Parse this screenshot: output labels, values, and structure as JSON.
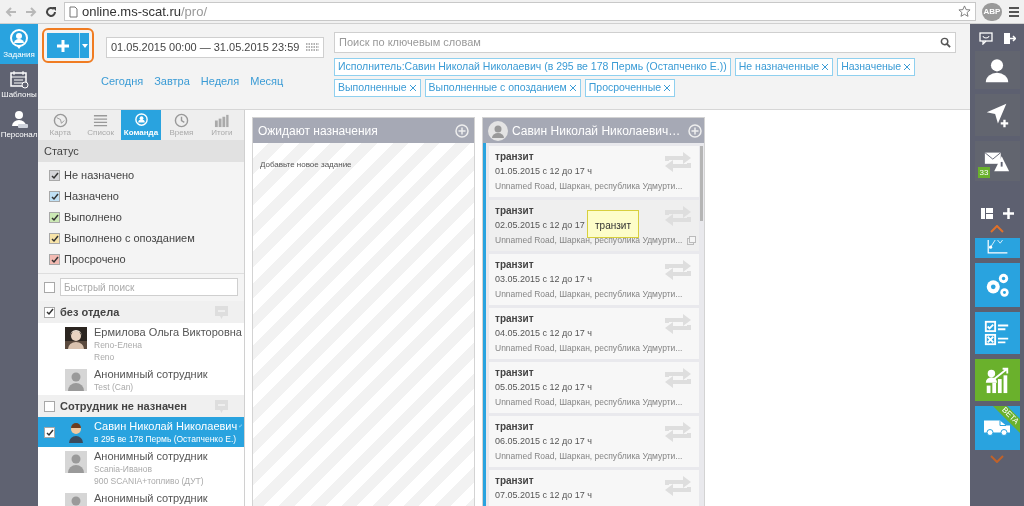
{
  "browser": {
    "url_host": "online.ms-scat.ru",
    "url_path": "/pro/",
    "extension": "ABP"
  },
  "left_nav": [
    {
      "kind": "tasks",
      "label": "Задания",
      "selected": true
    },
    {
      "kind": "templates",
      "label": "Шаблоны",
      "selected": false
    },
    {
      "kind": "staff",
      "label": "Персонал",
      "selected": false
    }
  ],
  "toolbar": {
    "date_range": "01.05.2015 00:00 — 31.05.2015 23:59",
    "quick_ranges": [
      "Сегодня",
      "Завтра",
      "Неделя",
      "Месяц"
    ],
    "search": {
      "placeholder": "Поиск по ключевым словам"
    },
    "filters": [
      "Исполнитель:Савин Николай Николаевич (в 295 ве 178 Пермь (Остапченко Е.))",
      "Не назначенные",
      "Назначеные",
      "Выполненные",
      "Выполненные с опозданием",
      "Просроченные"
    ]
  },
  "view_tabs": [
    {
      "kind": "map",
      "label": "Карта",
      "selected": false
    },
    {
      "kind": "list",
      "label": "Список",
      "selected": false
    },
    {
      "kind": "team",
      "label": "Команда",
      "selected": true
    },
    {
      "kind": "time",
      "label": "Время",
      "selected": false
    },
    {
      "kind": "totals",
      "label": "Итоги",
      "selected": false
    }
  ],
  "status": {
    "title": "Статус",
    "items": [
      {
        "label": "Не назначено",
        "checked": true,
        "color": "#d4d4d8"
      },
      {
        "label": "Назначено",
        "checked": true,
        "color": "#bfe0f5"
      },
      {
        "label": "Выполнено",
        "checked": true,
        "color": "#cbe8b4"
      },
      {
        "label": "Выполнено с опозданием",
        "checked": true,
        "color": "#f7e3a8"
      },
      {
        "label": "Просрочено",
        "checked": true,
        "color": "#f2bab2"
      }
    ]
  },
  "quick_search": {
    "placeholder": "Быстрый поиск",
    "checked": false
  },
  "groups": [
    {
      "name": "без отдела",
      "checked": true,
      "members": [
        {
          "name": "Ермилова Ольга Викторовна",
          "lines": [
            "Reno-Елена",
            "Reno"
          ],
          "selected": false
        },
        {
          "name": "Анонимный сотрудник",
          "lines": [
            "Test (Can)"
          ],
          "kind": "anonymous",
          "selected": false
        }
      ]
    },
    {
      "name": "Сотрудник не назначен",
      "checked": false,
      "members": [
        {
          "name": "Савин Николай Николаевич",
          "lines": [
            "в 295 ве 178 Пермь (Остапченко Е.)"
          ],
          "kind": "figure",
          "selected": true
        },
        {
          "name": "Анонимный сотрудник",
          "lines": [
            "Scania-Иванов",
            "900 SCANIA+топливо (ДУТ)"
          ],
          "kind": "anonymous",
          "selected": false
        },
        {
          "name": "Анонимный сотрудник",
          "kind": "anonymous",
          "selected": false
        }
      ]
    }
  ],
  "board": {
    "columns": [
      {
        "kind": "unassigned",
        "title": "Ожидают назначения",
        "empty_text": "Добавьте новое задание"
      },
      {
        "kind": "person",
        "title": "Савин Николай Николаевич…",
        "cards": [
          {
            "title": "транзит",
            "date": "01.05.2015 с 12 до 17 ч",
            "address": "Unnamed Road, Шаркан, республика Удмурти...",
            "hovered": false
          },
          {
            "title": "транзит",
            "date": "02.05.2015 с 12 до 17",
            "address": "Unnamed Road, Шаркан, республика Удмурти...",
            "hovered": true,
            "tooltip": "транзит"
          },
          {
            "title": "транзит",
            "date": "03.05.2015 с 12 до 17 ч",
            "address": "Unnamed Road, Шаркан, республика Удмурти...",
            "hovered": false
          },
          {
            "title": "транзит",
            "date": "04.05.2015 с 12 до 17 ч",
            "address": "Unnamed Road, Шаркан, республика Удмурти...",
            "hovered": false
          },
          {
            "title": "транзит",
            "date": "05.05.2015 с 12 до 17 ч",
            "address": "Unnamed Road, Шаркан, республика Удмурти...",
            "hovered": false
          },
          {
            "title": "транзит",
            "date": "06.05.2015 с 12 до 17 ч",
            "address": "Unnamed Road, Шаркан, республика Удмурти...",
            "hovered": false
          },
          {
            "title": "транзит",
            "date": "07.05.2015 с 12 до 17 ч"
          }
        ]
      }
    ]
  },
  "right_panel": {
    "tiles": [
      {
        "kind": "profile"
      },
      {
        "kind": "route"
      },
      {
        "kind": "alerts",
        "badge": "33"
      },
      {
        "kind": "chart"
      },
      {
        "kind": "settings"
      },
      {
        "kind": "checklist"
      },
      {
        "kind": "analytics"
      },
      {
        "kind": "vehicles",
        "ribbon": "BETA"
      }
    ]
  }
}
